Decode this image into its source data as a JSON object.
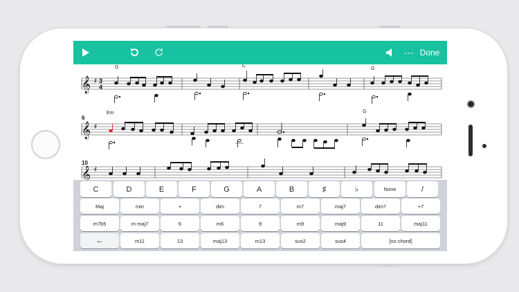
{
  "toolbar": {
    "play_icon": "play-icon",
    "undo_icon": "undo-icon",
    "redo_icon": "redo-icon",
    "volume_icon": "speaker-icon",
    "tempo_text": "---",
    "done_label": "Done"
  },
  "score": {
    "measure_numbers": [
      "6",
      "10"
    ],
    "chords_row1": [
      "G",
      "C",
      "G"
    ],
    "chords_row2": [
      "Em",
      "G"
    ],
    "time_signature": [
      "3",
      "4"
    ],
    "key_signature": "♯"
  },
  "keyboard": {
    "row1": [
      "C",
      "D",
      "E",
      "F",
      "G",
      "A",
      "B",
      "♯",
      "♭",
      "None",
      "/"
    ],
    "row2": [
      "Maj",
      "min",
      "+",
      "dim",
      "7",
      "m7",
      "maj7",
      "dim7",
      "+7"
    ],
    "row3": [
      "m7b5",
      "m maj7",
      "6",
      "m6",
      "9",
      "m9",
      "maj9",
      "11",
      "maj11"
    ],
    "row4_back": "←",
    "row4": [
      "m11",
      "13",
      "maj13",
      "m13",
      "sus2",
      "sus4",
      "[no chord]"
    ]
  },
  "colors": {
    "toolbar": "#16c2a0",
    "selected_note": "#e02020"
  }
}
